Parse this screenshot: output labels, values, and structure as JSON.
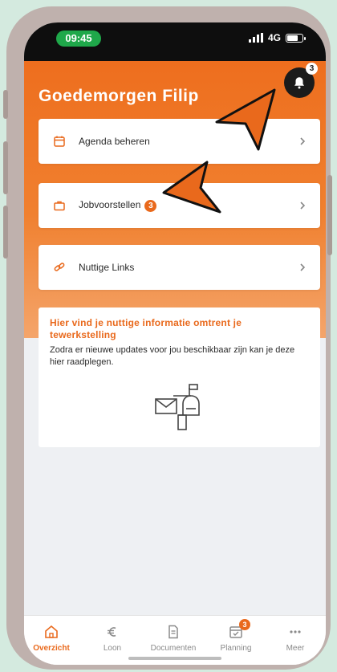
{
  "status_bar": {
    "time": "09:45",
    "network": "4G",
    "time_pill_color": "#1fa84a"
  },
  "header": {
    "greeting": "Goedemorgen Filip",
    "notification_count": "3"
  },
  "menu": [
    {
      "label": "Agenda beheren",
      "icon": "calendar-icon",
      "badge": ""
    },
    {
      "label": "Jobvoorstellen",
      "icon": "briefcase-icon",
      "badge": "3"
    },
    {
      "label": "Nuttige Links",
      "icon": "link-icon",
      "badge": ""
    }
  ],
  "info": {
    "title": "Hier vind je nuttige informatie omtrent je tewerkstelling",
    "text": "Zodra er nieuwe updates voor jou beschikbaar zijn kan je deze hier raadplegen.",
    "illustration": "mailbox-icon"
  },
  "tabs": [
    {
      "label": "Overzicht",
      "icon": "home-icon",
      "active": true,
      "badge": ""
    },
    {
      "label": "Loon",
      "icon": "euro-icon",
      "active": false,
      "badge": ""
    },
    {
      "label": "Documenten",
      "icon": "document-icon",
      "active": false,
      "badge": ""
    },
    {
      "label": "Planning",
      "icon": "calendar-check-icon",
      "active": false,
      "badge": "3"
    },
    {
      "label": "Meer",
      "icon": "more-icon",
      "active": false,
      "badge": ""
    }
  ],
  "colors": {
    "brand": "#e9691c",
    "dark": "#1b1b1b",
    "annotation_arrow": "#e9691c"
  }
}
